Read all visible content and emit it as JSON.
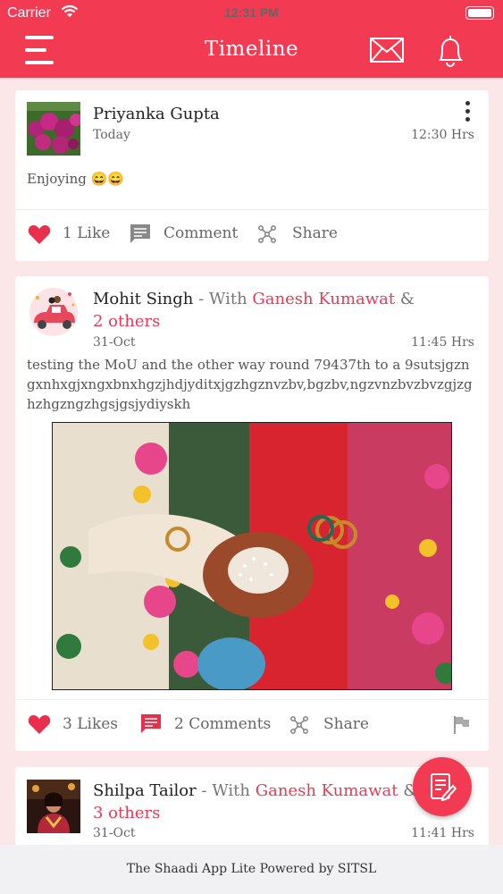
{
  "status_bar": {
    "carrier": "Carrier",
    "time": "12:31 PM"
  },
  "header": {
    "title": "Timeline"
  },
  "posts": [
    {
      "author": "Priyanka Gupta",
      "date": "Today",
      "time": "12:30 Hrs",
      "text": "Enjoying 😄😄",
      "likes": "1 Like",
      "comments": "Comment",
      "share": "Share"
    },
    {
      "author": "Mohit Singh",
      "with_label": " - With ",
      "tagged": "Ganesh Kumawat",
      "amp": " &",
      "others": "2 others",
      "date": "31-Oct",
      "time": "11:45 Hrs",
      "text": "testing the MoU and the other way round 79437th to a 9sutsjgzngxnhxgjxngxbnxhgzjhdjyditxjgzhgznvzbv,bgzbv,ngzvnzbvzbvzgjzghzhgzngzhgsjgsjydiyskh",
      "likes": "3 Likes",
      "comments": "2 Comments",
      "share": "Share"
    },
    {
      "author": "Shilpa Tailor",
      "with_label": " - With ",
      "tagged": "Ganesh Kumawat",
      "amp": " &",
      "others": "3 others",
      "date": "31-Oct",
      "time": "11:41 Hrs"
    }
  ],
  "footer": {
    "text": "The Shaadi App Lite Powered by SITSL"
  },
  "colors": {
    "brand": "#f23a52",
    "accent_text": "#e63a55",
    "background": "#fbe6e8"
  }
}
